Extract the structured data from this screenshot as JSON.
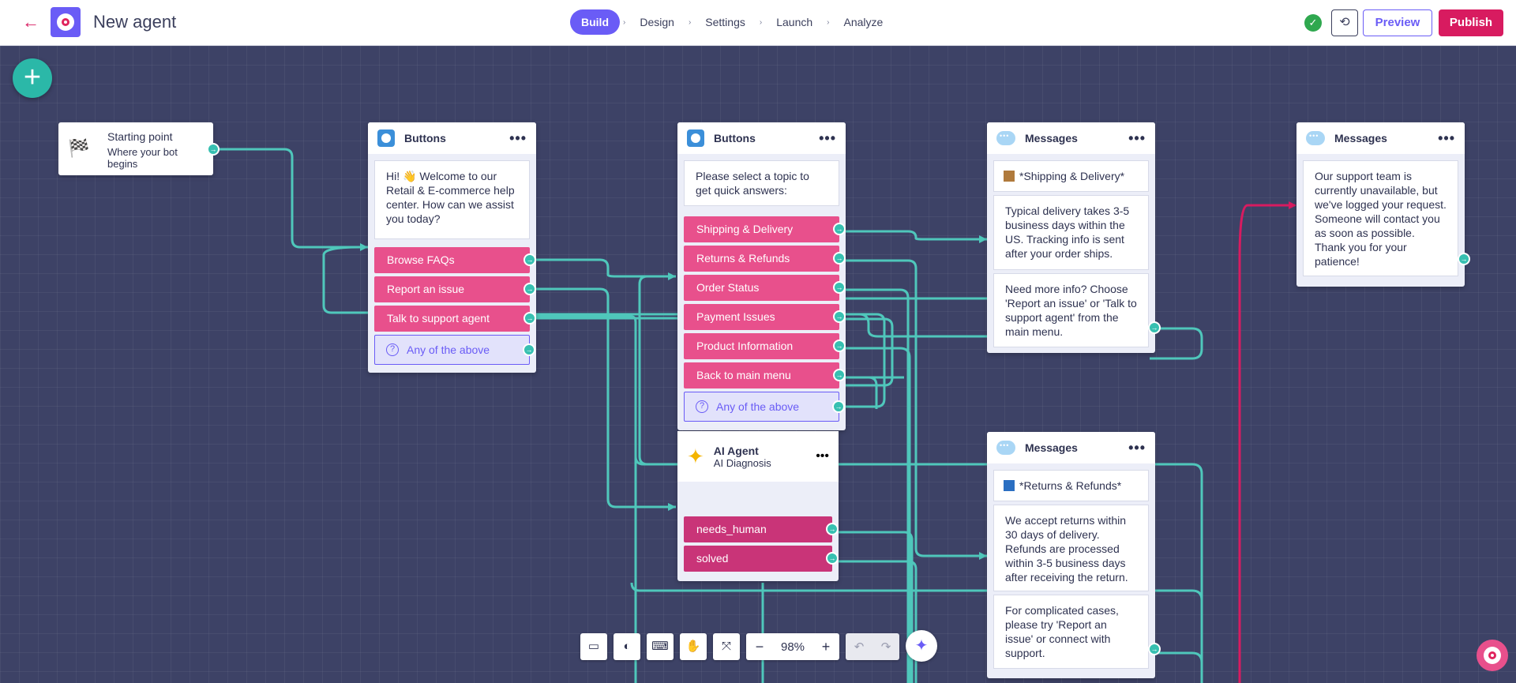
{
  "header": {
    "title": "New agent",
    "steps": [
      "Build",
      "Design",
      "Settings",
      "Launch",
      "Analyze"
    ],
    "preview_label": "Preview",
    "publish_label": "Publish"
  },
  "canvas": {
    "start": {
      "title": "Starting point",
      "subtitle": "Where your bot begins"
    },
    "buttons1": {
      "title": "Buttons",
      "message": "Hi! 👋 Welcome to our Retail & E-commerce help center. How can we assist you today?",
      "options": [
        "Browse FAQs",
        "Report an issue",
        "Talk to support agent"
      ],
      "fallback": "Any of the above"
    },
    "buttons2": {
      "title": "Buttons",
      "message": "Please select a topic to get quick answers:",
      "options": [
        "Shipping & Delivery",
        "Returns & Refunds",
        "Order Status",
        "Payment Issues",
        "Product Information",
        "Back to main menu"
      ],
      "fallback": "Any of the above"
    },
    "ai_agent": {
      "title": "AI Agent",
      "subtitle": "AI Diagnosis",
      "outcomes": [
        "needs_human",
        "solved"
      ]
    },
    "messages1": {
      "title": "Messages",
      "heading": "*Shipping & Delivery*",
      "paragraphs": [
        "Typical delivery takes 3-5 business days within the US. Tracking info is sent after your order ships.",
        "Need more info? Choose 'Report an issue' or 'Talk to support agent' from the main menu."
      ]
    },
    "messages2": {
      "title": "Messages",
      "paragraphs": [
        "Our support team is currently unavailable, but we've logged your request. Someone will contact you as soon as possible. Thank you for your patience!"
      ]
    },
    "messages3": {
      "title": "Messages",
      "heading": "*Returns & Refunds*",
      "paragraphs": [
        "We accept returns within 30 days of delivery. Refunds are processed within 3-5 business days after receiving the return.",
        "For complicated cases, please try 'Report an issue' or connect with support."
      ]
    },
    "zoom": "98%"
  },
  "colors": {
    "accent": "#6a5cf6",
    "brand": "#d81b60",
    "wire": "#4fc7bb",
    "option": "#e8508c"
  }
}
